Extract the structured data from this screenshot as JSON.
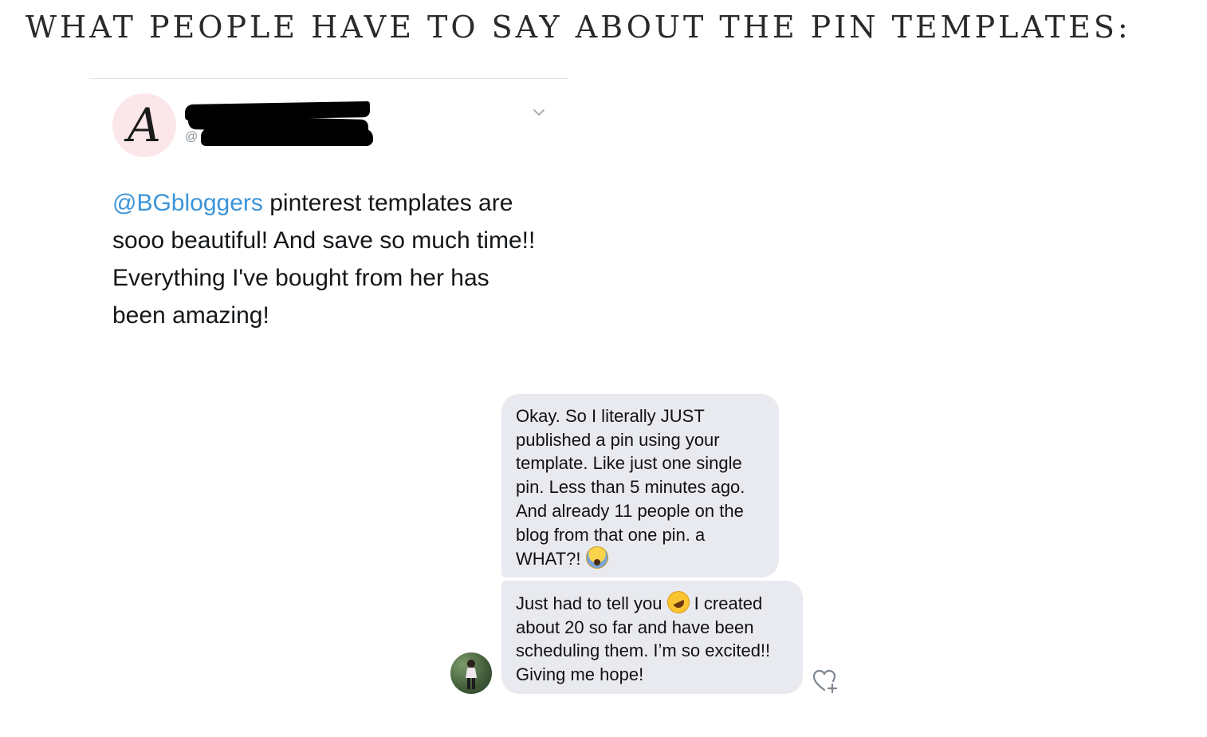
{
  "page": {
    "heading": "WHAT PEOPLE HAVE TO SAY ABOUT THE PIN TEMPLATES:"
  },
  "tweet": {
    "avatar_letter": "A",
    "handle_visible": "@",
    "mention": "@BGbloggers",
    "text": " pinterest templates are sooo beautiful! And save so much time!! Everything I've bought from her has been amazing!"
  },
  "messages": [
    {
      "text": "Okay. So I literally JUST published a pin using your template. Like just one single pin. Less than 5 minutes ago. And already 11 people on the blog from that one pin. a WHAT?!",
      "emoji": "face-screaming-in-fear"
    },
    {
      "text_before_emoji": "Just had to tell you ",
      "emoji": "rolling-on-the-floor-laughing",
      "text_after_emoji": " I created about 20 so far and have been scheduling them. I’m so excited!! Giving me hope!"
    }
  ],
  "icons": {
    "tweet_menu": "chevron-down-icon",
    "like": "heart-add-icon"
  },
  "colors": {
    "mention": "#3b94d9",
    "bubble": "#e9eaef",
    "avatar_bg": "#fbe6ea"
  }
}
